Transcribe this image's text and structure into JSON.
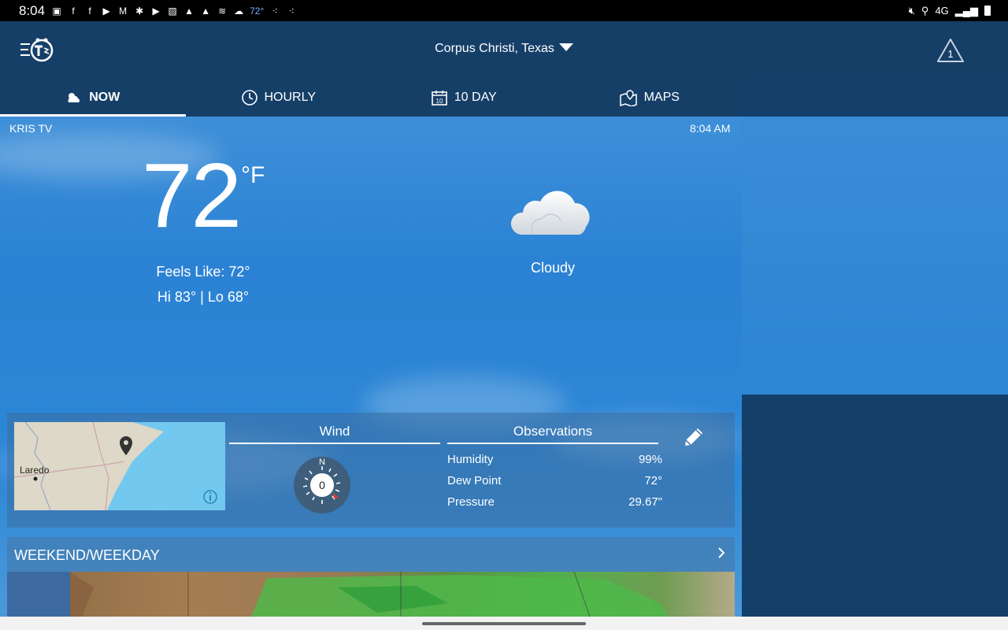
{
  "status_bar": {
    "time": "8:04",
    "temp": "72°",
    "network": "4G"
  },
  "header": {
    "location": "Corpus Christi, Texas",
    "alert_count": "1"
  },
  "tabs": [
    {
      "label": "NOW",
      "icon": "partly-cloudy-icon",
      "active": true
    },
    {
      "label": "HOURLY",
      "icon": "clock-icon",
      "active": false
    },
    {
      "label": "10 DAY",
      "icon": "calendar-icon",
      "active": false
    },
    {
      "label": "MAPS",
      "icon": "map-pin-icon",
      "active": false
    }
  ],
  "calendar_icon_number": "10",
  "now": {
    "station": "KRIS TV",
    "time": "8:04 AM",
    "temperature": "72",
    "unit": "°F",
    "feels_like": "Feels Like: 72°",
    "hi_lo": "Hi 83° | Lo 68°",
    "condition": "Cloudy"
  },
  "minimap": {
    "city_label": "Laredo"
  },
  "wind": {
    "title": "Wind",
    "direction_label": "N",
    "speed": "0"
  },
  "observations": {
    "title": "Observations",
    "rows": [
      {
        "label": "Humidity",
        "value": "99%"
      },
      {
        "label": "Dew Point",
        "value": "72°"
      },
      {
        "label": "Pressure",
        "value": "29.67\""
      }
    ]
  },
  "weekend_card": {
    "label": "WEEKEND/WEEKDAY"
  },
  "colors": {
    "header_bg": "#163f68",
    "sky": "#2b82d4",
    "accent_red": "#e53935"
  }
}
